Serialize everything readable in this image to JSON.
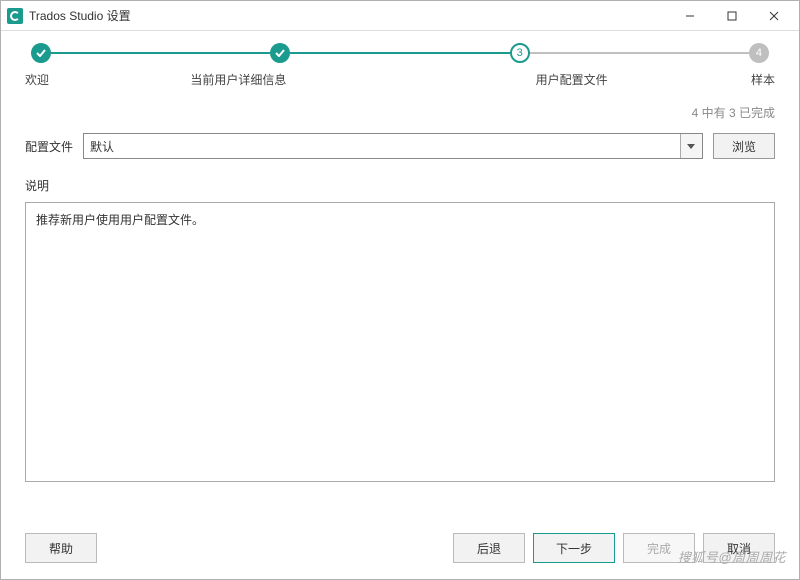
{
  "window": {
    "title": "Trados Studio 设置"
  },
  "wizard": {
    "steps": [
      {
        "label": "欢迎",
        "state": "done"
      },
      {
        "label": "当前用户详细信息",
        "state": "done"
      },
      {
        "label": "用户配置文件",
        "state": "current",
        "number": "3"
      },
      {
        "label": "样本",
        "state": "future",
        "number": "4"
      }
    ],
    "progress_text": "4 中有 3 已完成"
  },
  "form": {
    "profile_label": "配置文件",
    "profile_value": "默认",
    "browse_label": "浏览",
    "description_label": "说明",
    "description_text": "推荐新用户使用用户配置文件。"
  },
  "buttons": {
    "help": "帮助",
    "back": "后退",
    "next": "下一步",
    "finish": "完成",
    "cancel": "取消"
  },
  "watermark": "搜狐号@周周周花"
}
